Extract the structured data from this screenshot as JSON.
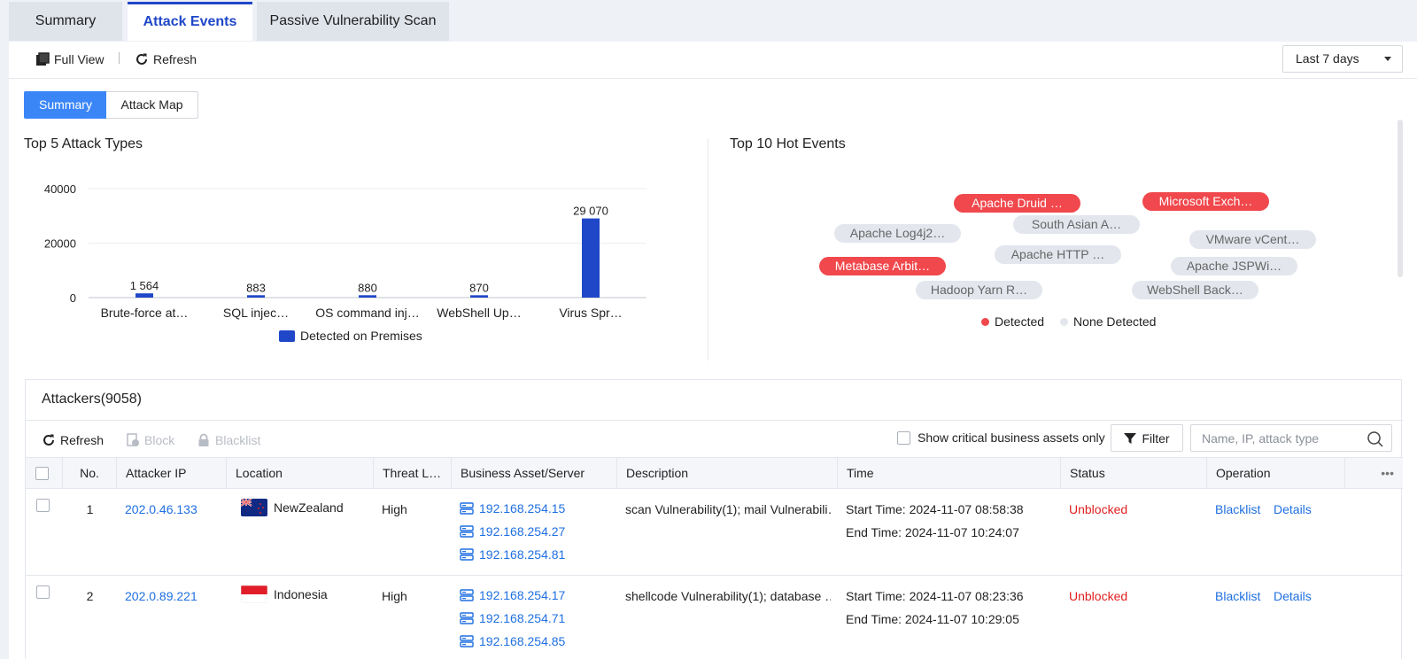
{
  "tabs": [
    "Summary",
    "Attack Events",
    "Passive Vulnerability Scan"
  ],
  "toolbar": {
    "full_view": "Full View",
    "refresh": "Refresh",
    "sep": "|",
    "range": "Last 7 days"
  },
  "view_toggle": [
    "Summary",
    "Attack Map"
  ],
  "chart_title": "Top 5 Attack Types",
  "chart_data": {
    "type": "bar",
    "categories": [
      "Brute-force at…",
      "SQL injec…",
      "OS command inj…",
      "WebShell Up…",
      "Virus Spr…"
    ],
    "series": [
      {
        "name": "Detected on Premises",
        "values": [
          1564,
          883,
          880,
          870,
          29070
        ],
        "labels": [
          "1 564",
          "883",
          "880",
          "870",
          "29 070"
        ]
      }
    ],
    "yticks": [
      "0",
      "20000",
      "40000"
    ],
    "ylim": [
      0,
      40000
    ],
    "grid": true,
    "legend": "bottom",
    "color": "#1f47c8"
  },
  "hot_title": "Top 10 Hot Events",
  "hot_events": [
    {
      "label": "Apache Druid …",
      "status": "detected"
    },
    {
      "label": "Microsoft Exch…",
      "status": "detected"
    },
    {
      "label": "South Asian A…",
      "status": "none"
    },
    {
      "label": "Apache Log4j2…",
      "status": "none"
    },
    {
      "label": "VMware vCent…",
      "status": "none"
    },
    {
      "label": "Apache HTTP …",
      "status": "none"
    },
    {
      "label": "Metabase Arbit…",
      "status": "detected"
    },
    {
      "label": "Apache JSPWi…",
      "status": "none"
    },
    {
      "label": "Hadoop Yarn R…",
      "status": "none"
    },
    {
      "label": "WebShell Back…",
      "status": "none"
    }
  ],
  "hot_legend": {
    "detected": "Detected",
    "none": "None Detected",
    "detected_color": "#f0484c",
    "none_color": "#e3e6ed"
  },
  "attackers": {
    "title": "Attackers(9058)",
    "tools": {
      "refresh": "Refresh",
      "block": "Block",
      "blacklist": "Blacklist"
    },
    "critical_only": "Show critical business assets only",
    "filter": "Filter",
    "search_placeholder": "Name, IP, attack type",
    "columns": [
      "No.",
      "Attacker IP",
      "Location",
      "Threat L…",
      "Business Asset/Server",
      "Description",
      "Time",
      "Status",
      "Operation"
    ],
    "rows": [
      {
        "no": "1",
        "ip": "202.0.46.133",
        "location": "NewZealand",
        "threat": "High",
        "assets": [
          "192.168.254.15",
          "192.168.254.27",
          "192.168.254.81"
        ],
        "description": "scan Vulnerability(1); mail Vulnerabili…",
        "start": "Start Time: 2024-11-07 08:58:38",
        "end": "End Time: 2024-11-07 10:24:07",
        "status": "Unblocked",
        "op1": "Blacklist",
        "op2": "Details"
      },
      {
        "no": "2",
        "ip": "202.0.89.221",
        "location": "Indonesia",
        "threat": "High",
        "assets": [
          "192.168.254.17",
          "192.168.254.71",
          "192.168.254.85"
        ],
        "description": "shellcode Vulnerability(1); database …",
        "start": "Start Time: 2024-11-07 08:23:36",
        "end": "End Time: 2024-11-07 10:29:05",
        "status": "Unblocked",
        "op1": "Blacklist",
        "op2": "Details"
      }
    ]
  }
}
